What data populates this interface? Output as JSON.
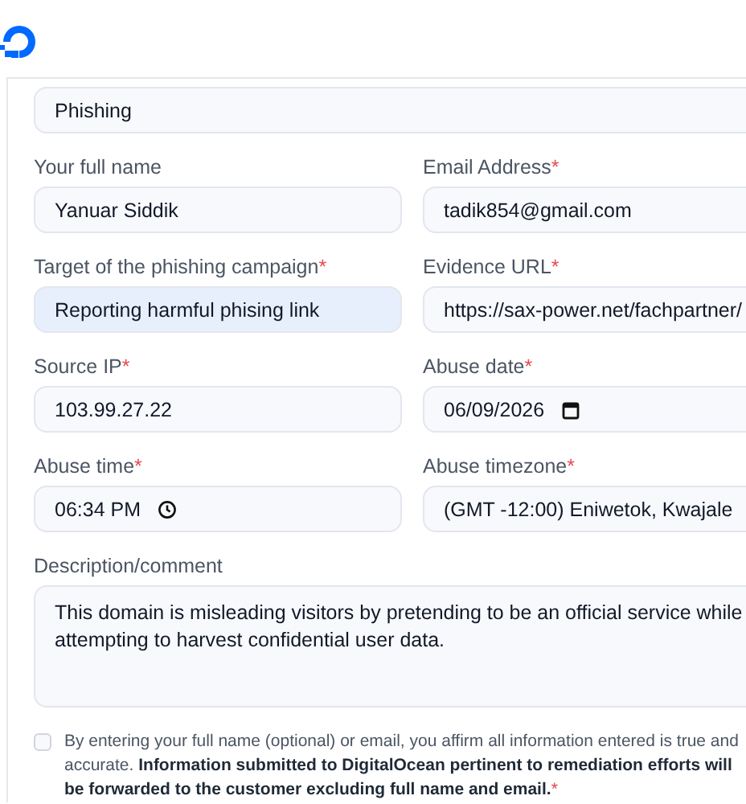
{
  "category": {
    "value": "Phishing"
  },
  "fields": [
    {
      "label": "Your full name",
      "kind": "text",
      "value": "Yanuar Siddik",
      "autofilled": false
    },
    {
      "label": "Email Address",
      "required_mark": "*",
      "kind": "text",
      "value": "tadik854@gmail.com",
      "autofilled": false
    },
    {
      "label": "Target of the phishing campaign",
      "required_mark": "*",
      "kind": "text",
      "value": "Reporting harmful phising link",
      "autofilled": true
    },
    {
      "label": "Evidence URL",
      "required_mark": "*",
      "kind": "text",
      "value": "https://sax-power.net/fachpartner/",
      "autofilled": false
    },
    {
      "label": "Source IP",
      "required_mark": "*",
      "kind": "text",
      "value": "103.99.27.22",
      "autofilled": false
    },
    {
      "label": "Abuse date",
      "required_mark": "*",
      "kind": "date",
      "value": "06/09/2026",
      "autofilled": false
    },
    {
      "label": "Abuse time",
      "required_mark": "*",
      "kind": "time",
      "value": "06:34 PM",
      "autofilled": false
    },
    {
      "label": "Abuse timezone",
      "required_mark": "*",
      "kind": "select",
      "value": "(GMT -12:00) Eniwetok, Kwajale",
      "autofilled": false
    }
  ],
  "description": {
    "label": "Description/comment",
    "value": "This domain is misleading visitors by pretending to be an official service while attempting to harvest confidential user data."
  },
  "consent": {
    "checked": false,
    "text": "By entering your full name (optional) or email, you affirm all information entered is true and accurate. **Information submitted to DigitalOcean pertinent to remediation efforts will be forwarded to the customer excluding full name and email.**",
    "required_mark": "*"
  }
}
